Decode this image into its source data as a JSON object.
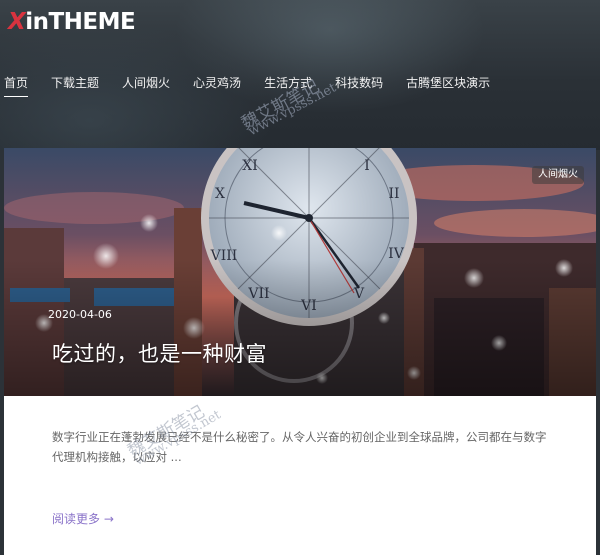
{
  "site": {
    "logo_prefix": "X",
    "logo_suffix": "inTHEME"
  },
  "nav": {
    "items": [
      {
        "label": "首页",
        "active": true
      },
      {
        "label": "下载主题",
        "active": false
      },
      {
        "label": "人间烟火",
        "active": false
      },
      {
        "label": "心灵鸡汤",
        "active": false
      },
      {
        "label": "生活方式",
        "active": false
      },
      {
        "label": "科技数码",
        "active": false
      },
      {
        "label": "古腾堡区块演示",
        "active": false
      }
    ]
  },
  "post": {
    "category": "人间烟火",
    "date": "2020-04-06",
    "title": "吃过的，也是一种财富",
    "excerpt": "数字行业正在蓬勃发展已经不是什么秘密了。从令人兴奋的初创企业到全球品牌，公司都在与数字代理机构接触，以应对 ...",
    "read_more": "阅读更多 →"
  },
  "watermark": {
    "name": "魏艾斯笔记",
    "url": "www.vpsss.net"
  },
  "colors": {
    "brand_accent": "#d9333f",
    "read_more": "#8a73c9"
  },
  "icons": {
    "read_more_arrow": "right-arrow-icon"
  }
}
